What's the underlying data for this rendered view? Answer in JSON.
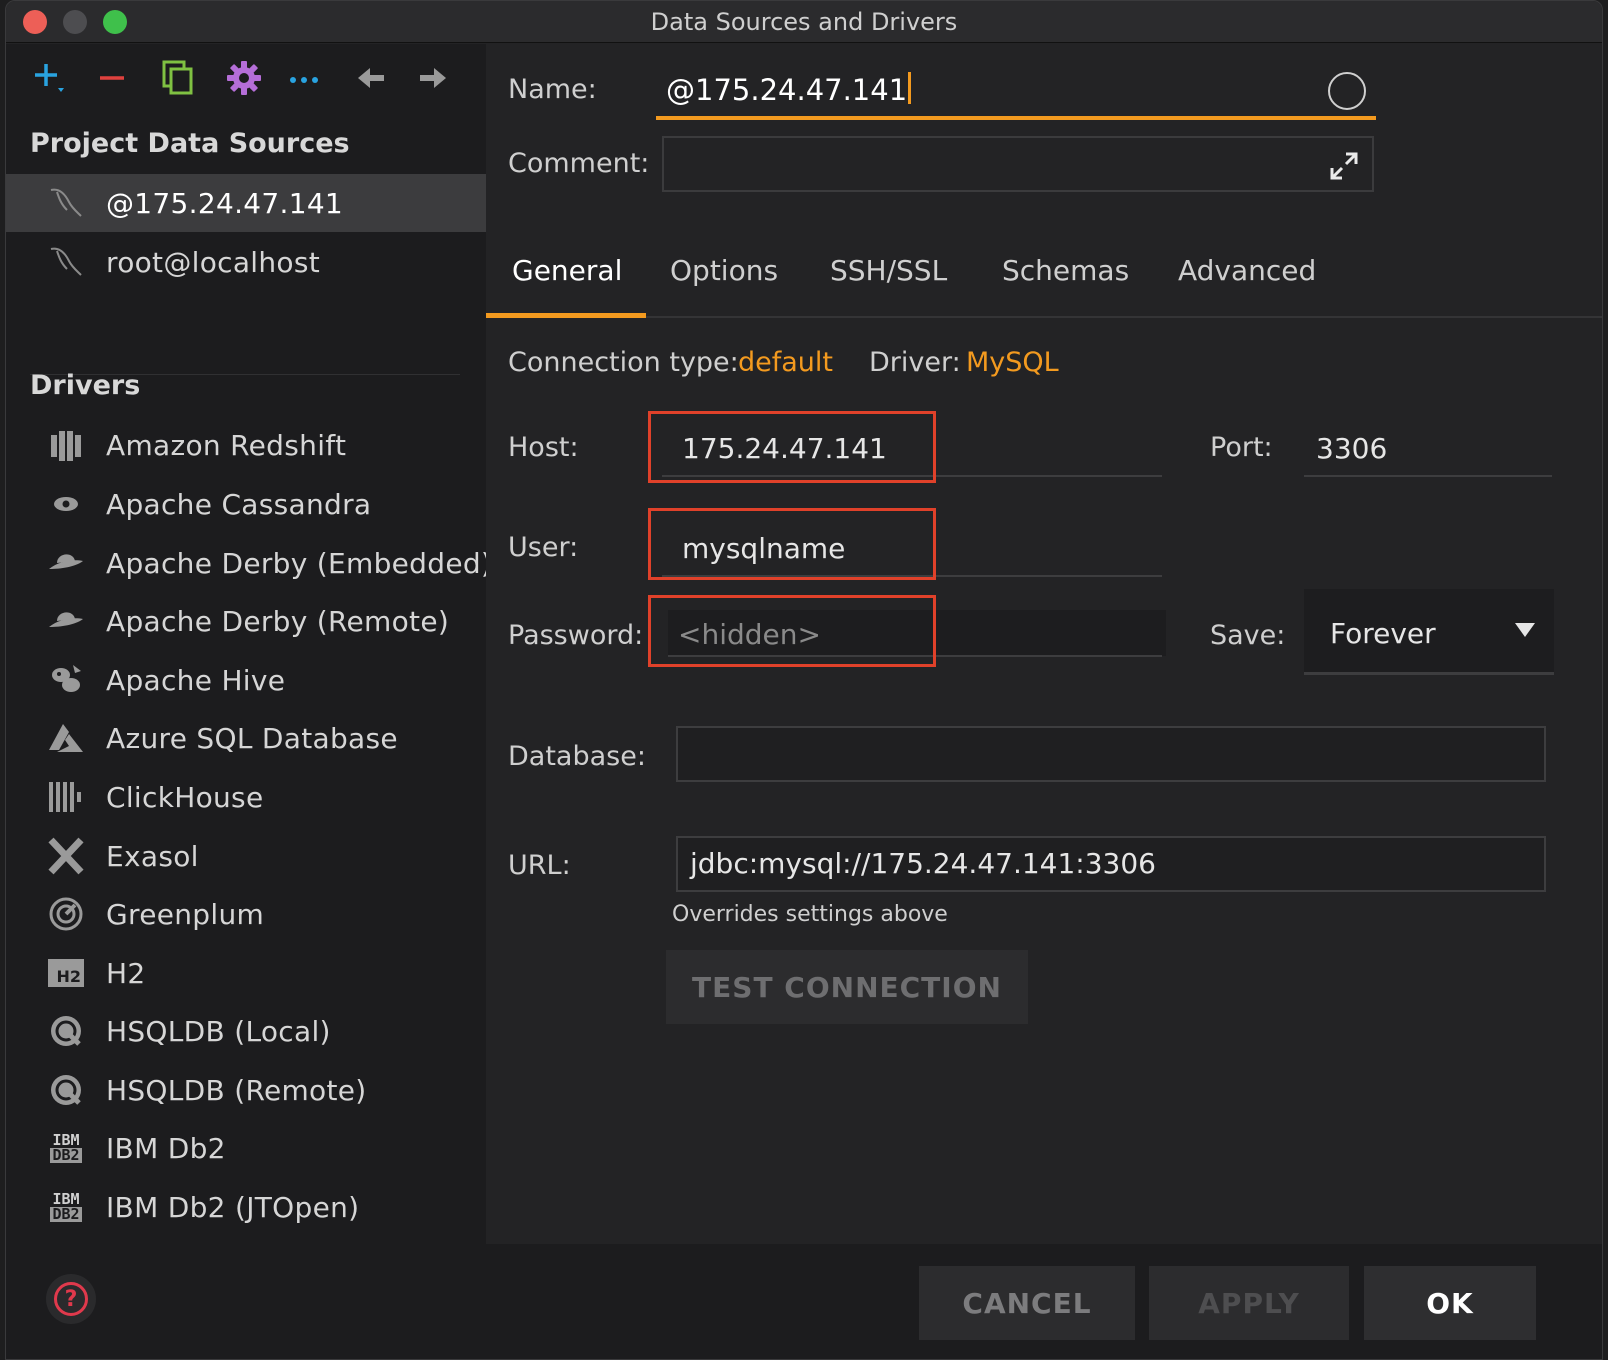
{
  "window": {
    "title": "Data Sources and Drivers"
  },
  "toolbar": {
    "add_icon": "plus-icon",
    "remove_icon": "minus-icon",
    "duplicate_icon": "copy-icon",
    "settings_icon": "gear-icon",
    "more_icon": "more-icon",
    "back_icon": "arrow-left-icon",
    "forward_icon": "arrow-right-icon",
    "colors": {
      "add": "#29a3e0",
      "remove": "#e0413e",
      "duplicate": "#7fc142",
      "settings": "#b56ed8",
      "more": "#29a3e0",
      "nav": "#9a9a9a"
    }
  },
  "sidebar": {
    "project_title": "Project Data Sources",
    "data_sources": [
      {
        "label": "@175.24.47.141",
        "icon": "mysql-dolphin-icon",
        "selected": true
      },
      {
        "label": "root@localhost",
        "icon": "mysql-dolphin-icon",
        "selected": false
      }
    ],
    "drivers_title": "Drivers",
    "drivers": [
      {
        "label": "Amazon Redshift",
        "icon": "redshift-icon"
      },
      {
        "label": "Apache Cassandra",
        "icon": "cassandra-eye-icon"
      },
      {
        "label": "Apache Derby (Embedded)",
        "icon": "derby-hat-icon"
      },
      {
        "label": "Apache Derby (Remote)",
        "icon": "derby-hat-icon"
      },
      {
        "label": "Apache Hive",
        "icon": "hive-bee-icon"
      },
      {
        "label": "Azure SQL Database",
        "icon": "azure-icon"
      },
      {
        "label": "ClickHouse",
        "icon": "clickhouse-bars-icon"
      },
      {
        "label": "Exasol",
        "icon": "exasol-x-icon"
      },
      {
        "label": "Greenplum",
        "icon": "greenplum-icon"
      },
      {
        "label": "H2",
        "icon": "h2-icon"
      },
      {
        "label": "HSQLDB (Local)",
        "icon": "hsqldb-icon"
      },
      {
        "label": "HSQLDB (Remote)",
        "icon": "hsqldb-icon"
      },
      {
        "label": "IBM Db2",
        "icon": "ibm-db2-icon"
      },
      {
        "label": "IBM Db2 (JTOpen)",
        "icon": "ibm-db2-icon"
      }
    ],
    "h2_badge": "H2",
    "ibm_badge_top": "IBM",
    "ibm_badge_bottom": "DB2"
  },
  "form": {
    "name_label": "Name:",
    "name_value": "@175.24.47.141",
    "comment_label": "Comment:",
    "comment_value": "",
    "tabs": [
      {
        "label": "General",
        "active": true
      },
      {
        "label": "Options",
        "active": false
      },
      {
        "label": "SSH/SSL",
        "active": false
      },
      {
        "label": "Schemas",
        "active": false
      },
      {
        "label": "Advanced",
        "active": false
      }
    ],
    "connection_type_label": "Connection type:",
    "connection_type_value": "default",
    "driver_label": "Driver:",
    "driver_value": "MySQL",
    "host_label": "Host:",
    "host_value": "175.24.47.141",
    "port_label": "Port:",
    "port_value": "3306",
    "user_label": "User:",
    "user_value": "mysqlname",
    "password_label": "Password:",
    "password_placeholder": "<hidden>",
    "save_label": "Save:",
    "save_value": "Forever",
    "database_label": "Database:",
    "database_value": "",
    "url_label": "URL:",
    "url_value": "jdbc:mysql://175.24.47.141:3306",
    "url_hint": "Overrides settings above",
    "test_connection": "TEST CONNECTION",
    "accent_color": "#f39a1f",
    "highlight_color": "#e0412a"
  },
  "footer": {
    "help_icon": "help-icon",
    "cancel": "CANCEL",
    "apply": "APPLY",
    "ok": "OK"
  }
}
